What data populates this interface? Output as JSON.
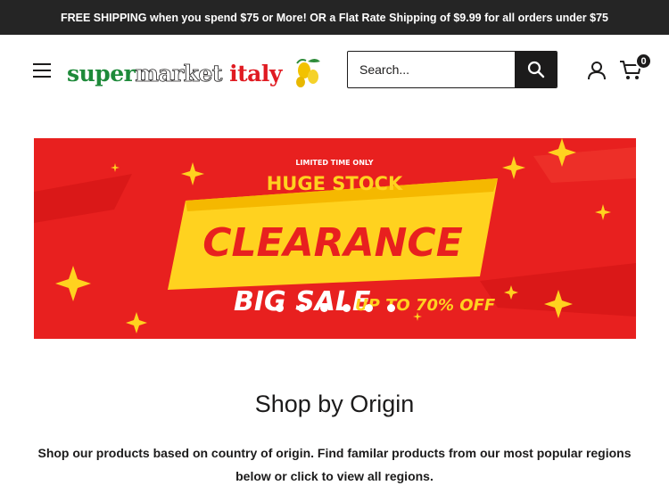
{
  "announcement": "FREE SHIPPING when you spend $75 or More! OR a Flat Rate Shipping of $9.99 for all orders under $75",
  "header": {
    "logo_text": "supermarket italy",
    "search_placeholder": "Search...",
    "cart_count": "0"
  },
  "banner": {
    "kicker": "LIMITED TIME ONLY",
    "headline": "HUGE STOCK",
    "main": "CLEARANCE",
    "sale": "BIG SALE",
    "offer": "UP TO 70% OFF",
    "slide_count": 6,
    "colors": {
      "background": "#e8201f",
      "accent": "#ffd21f"
    }
  },
  "origin_section": {
    "title": "Shop by Origin",
    "description": "Shop our products based on country of origin. Find familar products from our most popular regions below or click to view all regions."
  }
}
